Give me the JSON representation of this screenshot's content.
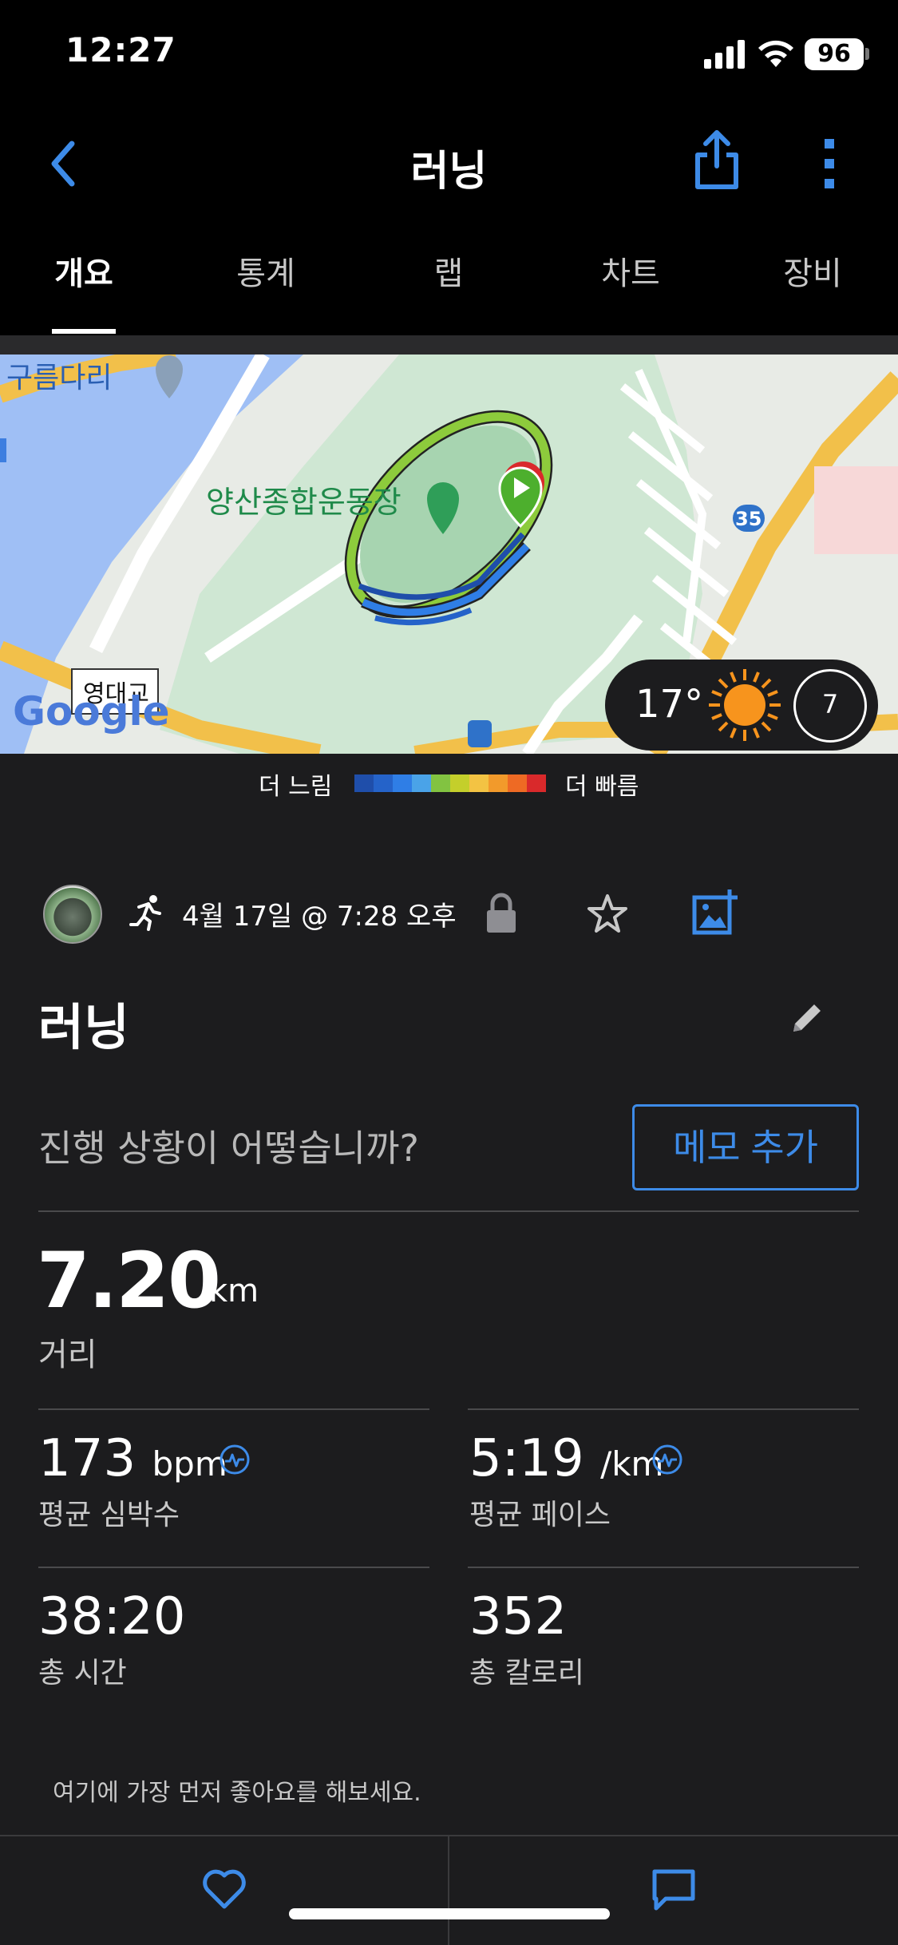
{
  "status": {
    "time": "12:27",
    "battery": "96"
  },
  "header": {
    "title": "러닝"
  },
  "tabs": [
    {
      "label": "개요"
    },
    {
      "label": "통계"
    },
    {
      "label": "랩"
    },
    {
      "label": "차트"
    },
    {
      "label": "장비"
    }
  ],
  "map": {
    "labels": {
      "bridge": "구름다리",
      "stadium": "양산종합운동장",
      "crossing": "영대교",
      "route_number": "35",
      "provider": "Google"
    },
    "weather": {
      "temperature": "17°",
      "wind": "7"
    }
  },
  "legend": {
    "slow": "더 느림",
    "fast": "더 빠름",
    "colors": [
      "#1f4eaa",
      "#2563c9",
      "#2f7ee6",
      "#4aa3e8",
      "#82c341",
      "#c4cf2b",
      "#f3c343",
      "#f29a2b",
      "#ee6a24",
      "#d9292b"
    ]
  },
  "activity": {
    "date": "4월 17일 @ 7:28 오후",
    "title": "러닝",
    "memo_prompt": "진행 상황이 어떻습니까?",
    "memo_button": "메모 추가"
  },
  "stats": {
    "distance": {
      "value": "7.20",
      "unit": "km",
      "label": "거리"
    },
    "avg_hr": {
      "value": "173",
      "unit": "bpm",
      "label": "평균 심박수"
    },
    "avg_pace": {
      "value": "5:19",
      "unit": "/km",
      "label": "평균 페이스"
    },
    "total_time": {
      "value": "38:20",
      "label": "총 시간"
    },
    "total_calories": {
      "value": "352",
      "label": "총 칼로리"
    }
  },
  "social": {
    "first_like": "여기에 가장 먼저 좋아요를 해보세요."
  },
  "colors": {
    "accent": "#3d8be8",
    "background": "#1c1c1e",
    "header": "#000000"
  }
}
